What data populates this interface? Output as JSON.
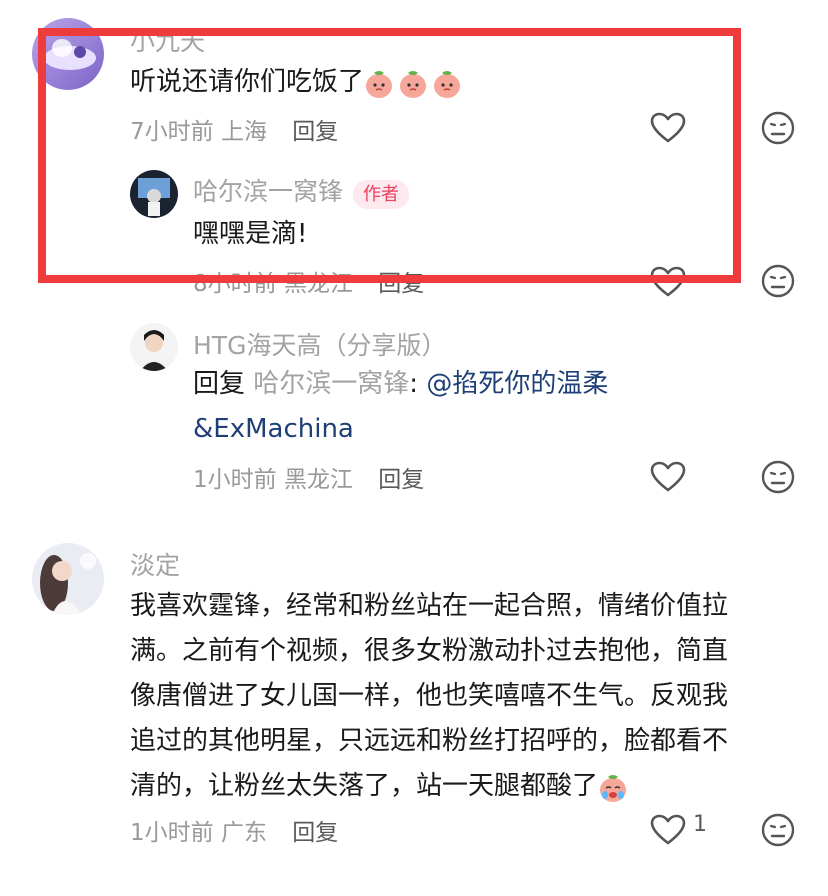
{
  "comments": [
    {
      "username": "小九天",
      "text": "听说还请你们吃饭了",
      "emoji_count": 3,
      "time": "7小时前",
      "location": "上海",
      "reply_label": "回复",
      "replies": [
        {
          "username": "哈尔滨一窝锋",
          "badge": "作者",
          "text": "嘿嘿是滴!",
          "time": "8小时前",
          "location": "黑龙江",
          "reply_label": "回复"
        },
        {
          "username": "HTG海天高（分享版）",
          "reply_prefix": "回复",
          "reply_target": "哈尔滨一窝锋",
          "colon": ":",
          "mention": "@掐死你的温柔&ExMachina",
          "mention_line1": "@掐死你的温柔",
          "mention_line2": "&ExMachina",
          "time": "1小时前",
          "location": "黑龙江",
          "reply_label": "回复"
        }
      ]
    },
    {
      "username": "淡定",
      "lines": [
        "我喜欢霆锋，经常和粉丝站在一起合照，情绪价值拉",
        "满。之前有个视频，很多女粉激动扑过去抱他，简直",
        "像唐僧进了女儿国一样，他也笑嘻嘻不生气。反观我",
        "追过的其他明星，只远远和粉丝打招呼的，脸都看不",
        "清的，让粉丝太失落了，站一天腿都酸了"
      ],
      "time": "1小时前",
      "location": "广东",
      "reply_label": "回复",
      "likes": "1"
    }
  ],
  "icons": {
    "like": "heart-outline-icon",
    "dislike": "meh-face-icon"
  },
  "colors": {
    "highlight": "#ee3b3b",
    "author_badge": "#f0405f",
    "mention": "#1f3f77"
  }
}
